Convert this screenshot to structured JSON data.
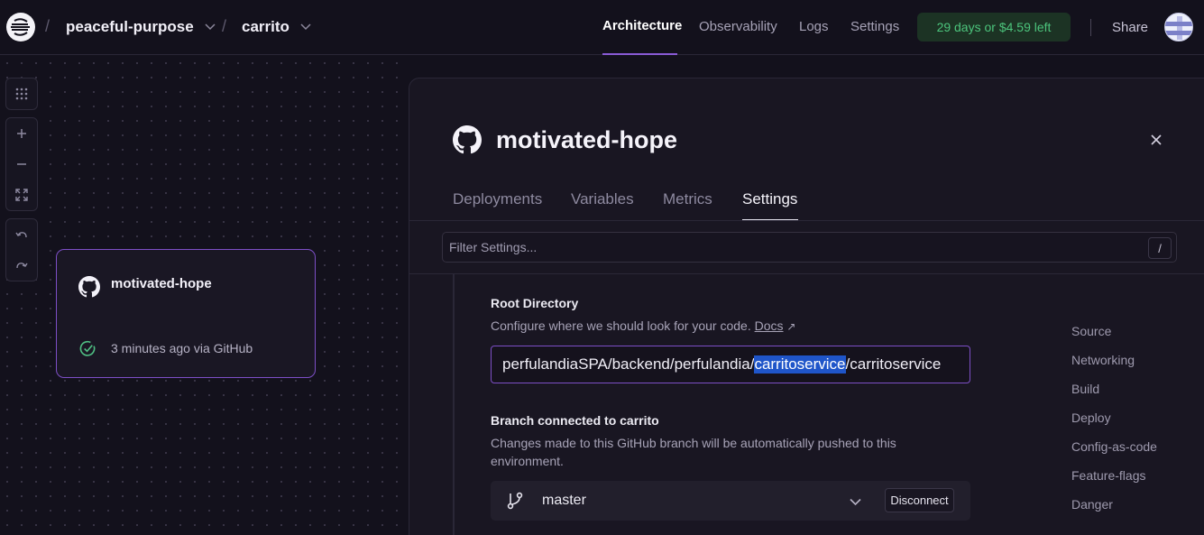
{
  "header": {
    "project": "peaceful-purpose",
    "environment": "carrito",
    "nav": [
      "Architecture",
      "Observability",
      "Logs",
      "Settings"
    ],
    "active_nav": "Architecture",
    "trial": "29 days or $4.59 left",
    "share": "Share"
  },
  "canvas": {
    "tools": [
      "grid-icon",
      "zoom-in-icon",
      "zoom-out-icon",
      "fit-view-icon",
      "undo-icon",
      "redo-icon"
    ],
    "service_card": {
      "name": "motivated-hope",
      "status": "3 minutes ago via GitHub"
    }
  },
  "panel": {
    "title": "motivated-hope",
    "tabs": [
      "Deployments",
      "Variables",
      "Metrics",
      "Settings"
    ],
    "active_tab": "Settings",
    "filter_placeholder": "Filter Settings...",
    "filter_shortcut": "/",
    "root_directory": {
      "label": "Root Directory",
      "description": "Configure where we should look for your code.",
      "docs_link": "Docs",
      "value_before": "perfulandiaSPA/backend/perfulandia/",
      "value_selected": "carritoservice",
      "value_after": "/carritoservice"
    },
    "branch": {
      "label": "Branch connected to carrito",
      "description": "Changes made to this GitHub branch will be automatically pushed to this environment.",
      "name": "master",
      "disconnect": "Disconnect"
    },
    "side_nav": [
      "Source",
      "Networking",
      "Build",
      "Deploy",
      "Config-as-code",
      "Feature-flags",
      "Danger"
    ]
  },
  "colors": {
    "accent": "#7d4fc6",
    "trial_bg": "#1c3324",
    "trial_text": "#4cc47c",
    "selection": "#1f55c9"
  }
}
